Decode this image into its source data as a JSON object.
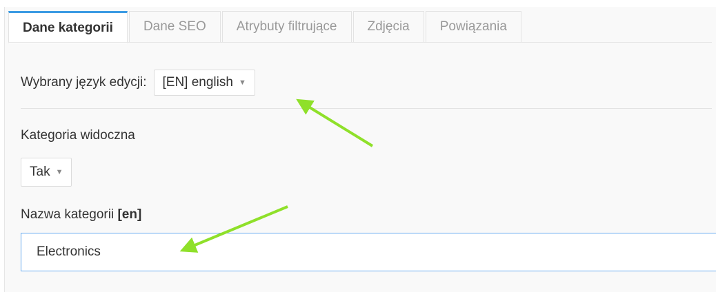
{
  "tabs": [
    {
      "label": "Dane kategorii",
      "active": true
    },
    {
      "label": "Dane SEO",
      "active": false
    },
    {
      "label": "Atrybuty filtrujące",
      "active": false
    },
    {
      "label": "Zdjęcia",
      "active": false
    },
    {
      "label": "Powiązania",
      "active": false
    }
  ],
  "language": {
    "label": "Wybrany język edycji:",
    "selected": "[EN] english"
  },
  "visibility": {
    "label": "Kategoria widoczna",
    "selected": "Tak"
  },
  "name_field": {
    "label": "Nazwa kategorii",
    "lang_tag": "[en]",
    "value": "Electronics"
  },
  "colors": {
    "accent": "#3c9be3",
    "annotation_arrow": "#8fe02a"
  }
}
